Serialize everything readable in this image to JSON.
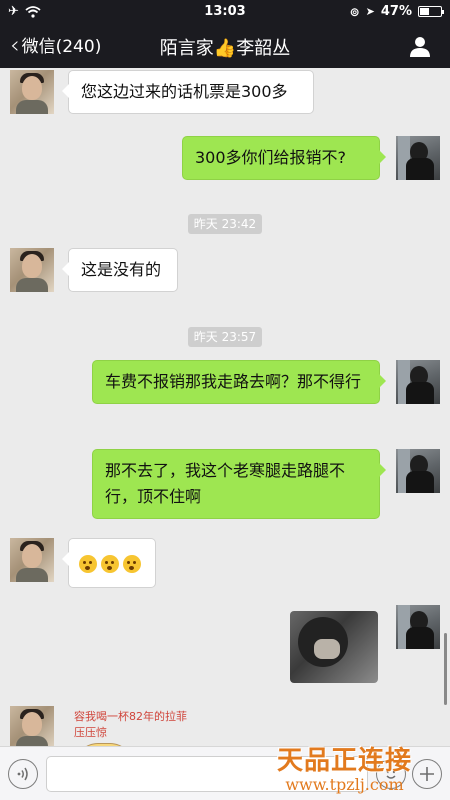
{
  "status_bar": {
    "time": "13:03",
    "battery": "47%",
    "battery_level": 0.47
  },
  "nav": {
    "back_label": "微信(240)",
    "title": "陌言家👍李韶丛"
  },
  "messages": [
    {
      "side": "left",
      "text": "您这边过来的话机票是300多"
    },
    {
      "side": "right",
      "text": "300多你们给报销不?"
    },
    {
      "type": "timestamp",
      "text": "昨天 23:42"
    },
    {
      "side": "left",
      "text": "这是没有的"
    },
    {
      "type": "timestamp",
      "text": "昨天 23:57"
    },
    {
      "side": "right",
      "text": "车费不报销那我走路去啊？那不得行"
    },
    {
      "side": "right",
      "text": "那不去了，我这个老寒腿走路腿不行，顶不住啊"
    },
    {
      "side": "left",
      "type": "emoji",
      "emoji_count": 3
    },
    {
      "side": "right",
      "type": "image"
    },
    {
      "side": "left",
      "type": "sticker",
      "text": "容我喝一杯82年的拉菲压压惊"
    }
  ],
  "watermark": {
    "title": "天品正连接",
    "url": "www.tpzlj.com"
  }
}
